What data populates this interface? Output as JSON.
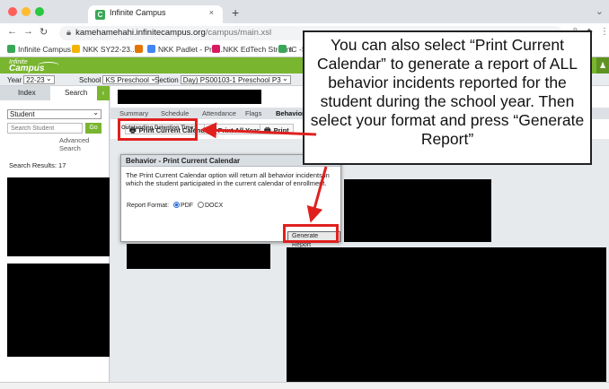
{
  "browser": {
    "tab_title": "Infinite Campus",
    "tab_close": "×",
    "new_tab": "+",
    "url_host": "kamehamehahi.infinitecampus.org",
    "url_path": "/campus/main.xsl",
    "bookmarks": [
      {
        "label": "Infinite Campus",
        "color": "#3aa757"
      },
      {
        "label": "NKK SY22-23...",
        "color": "#f4b400"
      },
      {
        "label": "",
        "color": "#e37400"
      },
      {
        "label": "NKK Padlet - Prof...",
        "color": "#4285f4"
      },
      {
        "label": "NKK EdTech Stream",
        "color": "#d81b60"
      },
      {
        "label": "IC -SA",
        "color": "#3aa757"
      }
    ]
  },
  "app": {
    "logo_top": "Infinite",
    "logo_bottom": "Campus",
    "year_label": "Year",
    "year_value": "22-23",
    "school_label": "School",
    "school_value": "KS Preschool",
    "section_label": "Section",
    "section_value": "Day) PS00103-1 Preschool P3",
    "left_tabs": {
      "index": "Index",
      "search": "Search",
      "toggle": "‹"
    },
    "search": {
      "type_value": "Student",
      "placeholder": "Search Student",
      "go": "Go",
      "advanced": "Advanced Search",
      "results": "Search Results: 17"
    },
    "subtabs": [
      "Summary",
      "Schedule",
      "Attendance",
      "Flags",
      "Behavior"
    ],
    "toolbar": {
      "print_current": "Print Current Calendar",
      "print_all": "Print All Years",
      "print": "Print"
    },
    "odt_label": "Outstanding Detention Time:"
  },
  "dialog": {
    "title": "Behavior - Print Current Calendar",
    "close": "✖",
    "body": "The Print Current Calendar option will return all behavior incidents in which the student participated in the current calendar of enrollment.",
    "format_label": "Report Format:",
    "format_pdf": "PDF",
    "format_docx": "DOCX",
    "generate": "Generate Report"
  },
  "callout": {
    "text": "You can also select “Print Current Calendar” to generate a report of ALL behavior incidents reported for the student during the school year. Then select your format and press “Generate Report”"
  },
  "colors": {
    "campus_green": "#79b52f",
    "highlight_red": "#e0201f"
  }
}
